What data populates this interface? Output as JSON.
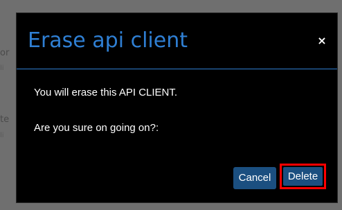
{
  "dialog": {
    "title": "Erase api client",
    "close_label": "×",
    "message_line_1": "You will erase this API CLIENT.",
    "message_line_2": "Are you sure on going on?:",
    "cancel_label": "Cancel",
    "delete_label": "Delete"
  },
  "background_fragments": [
    "or",
    "li",
    "te",
    "li"
  ],
  "colors": {
    "title": "#2f7fd3",
    "header_divider": "#2f7fd3",
    "button_bg": "#1b4f80",
    "highlight": "#ff0000",
    "modal_bg": "#000000",
    "backdrop": "#6f6f6f"
  },
  "icons": {
    "close": "close-icon"
  }
}
